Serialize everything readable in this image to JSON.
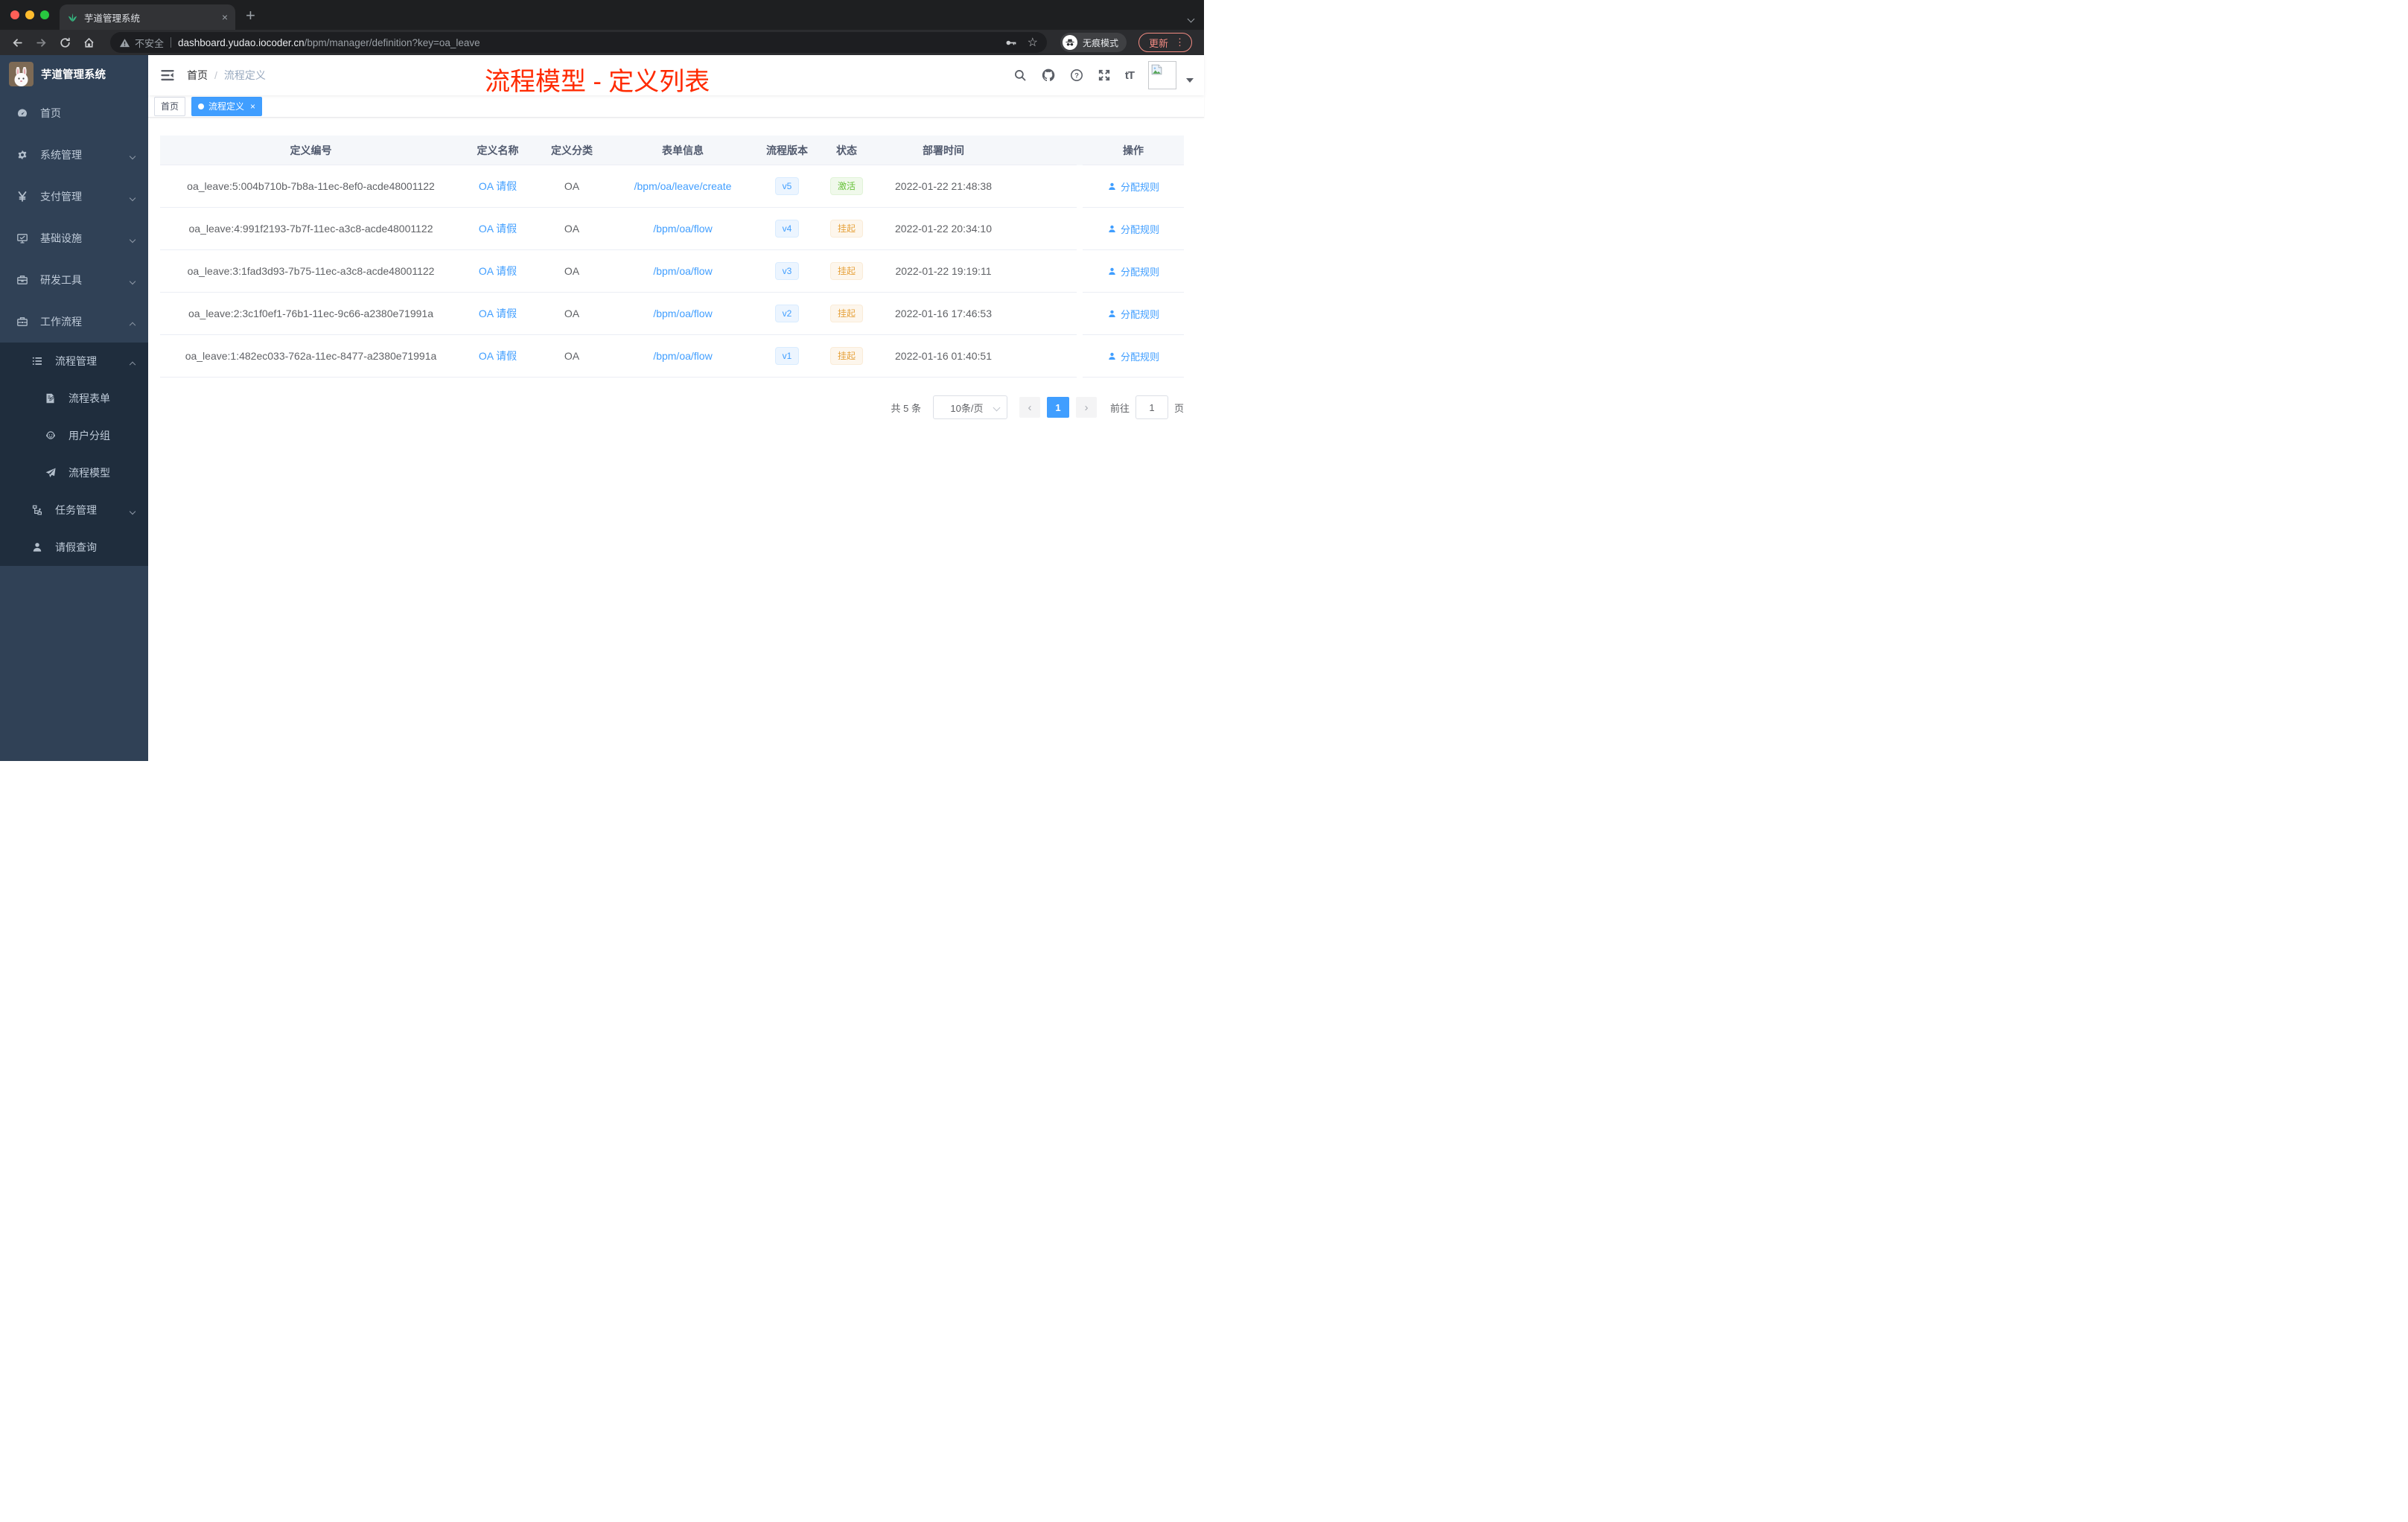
{
  "browser": {
    "tab": {
      "title": "芋道管理系统",
      "close": "×"
    },
    "new_tab": "+",
    "address": {
      "security": "不安全",
      "host": "dashboard.yudao.iocoder.cn",
      "path": "/bpm/manager/definition?key=oa_leave"
    },
    "incognito_label": "无痕模式",
    "update_label": "更新",
    "menu_dots": "⋮",
    "colors": {
      "tabstrip_bg": "#1e1f21",
      "toolbar_bg": "#2b2c2f",
      "omnibox_bg": "#1d1e21",
      "update_red": "#f28b82"
    }
  },
  "sidebar": {
    "app_title": "芋道管理系统",
    "colors": {
      "bg": "#304156",
      "submenu_bg": "#1f2d3d",
      "text": "#bfcbd9"
    },
    "menu": [
      {
        "label": "首页",
        "icon": "dashboard-icon",
        "level": 1
      },
      {
        "label": "系统管理",
        "icon": "gear-icon",
        "level": 1,
        "arrow": "down"
      },
      {
        "label": "支付管理",
        "icon": "yen-icon",
        "level": 1,
        "arrow": "down"
      },
      {
        "label": "基础设施",
        "icon": "monitor-icon",
        "level": 1,
        "arrow": "down"
      },
      {
        "label": "研发工具",
        "icon": "toolbox-icon",
        "level": 1,
        "arrow": "down"
      },
      {
        "label": "工作流程",
        "icon": "briefcase-icon",
        "level": 1,
        "arrow": "up"
      },
      {
        "label": "流程管理",
        "icon": "list-icon",
        "level": 2,
        "arrow": "up",
        "dark": true
      },
      {
        "label": "流程表单",
        "icon": "form-icon",
        "level": 3,
        "dark": true
      },
      {
        "label": "用户分组",
        "icon": "group-icon",
        "level": 3,
        "dark": true
      },
      {
        "label": "流程模型",
        "icon": "plane-icon",
        "level": 3,
        "dark": true
      },
      {
        "label": "任务管理",
        "icon": "tree-icon",
        "level": 2,
        "arrow": "down",
        "dark": true
      },
      {
        "label": "请假查询",
        "icon": "person-icon",
        "level": 2,
        "dark": true
      }
    ]
  },
  "navbar": {
    "breadcrumb": {
      "home": "首页",
      "separator": "/",
      "current": "流程定义"
    },
    "icons": [
      "search-icon",
      "github-icon",
      "help-icon",
      "fullscreen-icon",
      "font-size-icon",
      "avatar",
      "caret-down-icon"
    ]
  },
  "annotation": {
    "text": "流程模型 - 定义列表",
    "color": "#ff2a00"
  },
  "tags": [
    {
      "label": "首页",
      "active": false
    },
    {
      "label": "流程定义",
      "active": true,
      "close": "×"
    }
  ],
  "table": {
    "headers": [
      "定义编号",
      "定义名称",
      "定义分类",
      "表单信息",
      "流程版本",
      "状态",
      "部署时间",
      "操作"
    ],
    "rows": [
      {
        "id": "oa_leave:5:004b710b-7b8a-11ec-8ef0-acde48001122",
        "name": "OA 请假",
        "category": "OA",
        "form": "/bpm/oa/leave/create",
        "version": "v5",
        "status": "激活",
        "status_type": "success",
        "deploy_time": "2022-01-22 21:48:38",
        "action": "分配规则"
      },
      {
        "id": "oa_leave:4:991f2193-7b7f-11ec-a3c8-acde48001122",
        "name": "OA 请假",
        "category": "OA",
        "form": "/bpm/oa/flow",
        "version": "v4",
        "status": "挂起",
        "status_type": "warning",
        "deploy_time": "2022-01-22 20:34:10",
        "action": "分配规则"
      },
      {
        "id": "oa_leave:3:1fad3d93-7b75-11ec-a3c8-acde48001122",
        "name": "OA 请假",
        "category": "OA",
        "form": "/bpm/oa/flow",
        "version": "v3",
        "status": "挂起",
        "status_type": "warning",
        "deploy_time": "2022-01-22 19:19:11",
        "action": "分配规则"
      },
      {
        "id": "oa_leave:2:3c1f0ef1-76b1-11ec-9c66-a2380e71991a",
        "name": "OA 请假",
        "category": "OA",
        "form": "/bpm/oa/flow",
        "version": "v2",
        "status": "挂起",
        "status_type": "warning",
        "deploy_time": "2022-01-16 17:46:53",
        "action": "分配规则"
      },
      {
        "id": "oa_leave:1:482ec033-762a-11ec-8477-a2380e71991a",
        "name": "OA 请假",
        "category": "OA",
        "form": "/bpm/oa/flow",
        "version": "v1",
        "status": "挂起",
        "status_type": "warning",
        "deploy_time": "2022-01-16 01:40:51",
        "action": "分配规则"
      }
    ],
    "colors": {
      "link": "#409eff",
      "success": "#67c23a",
      "warning": "#e6a23c",
      "header_bg": "#f5f7fa"
    }
  },
  "pagination": {
    "total": "共 5 条",
    "page_size": "10条/页",
    "prev": "‹",
    "current_page": "1",
    "next": "›",
    "goto_label": "前往",
    "goto_value": "1",
    "page_unit": "页"
  }
}
